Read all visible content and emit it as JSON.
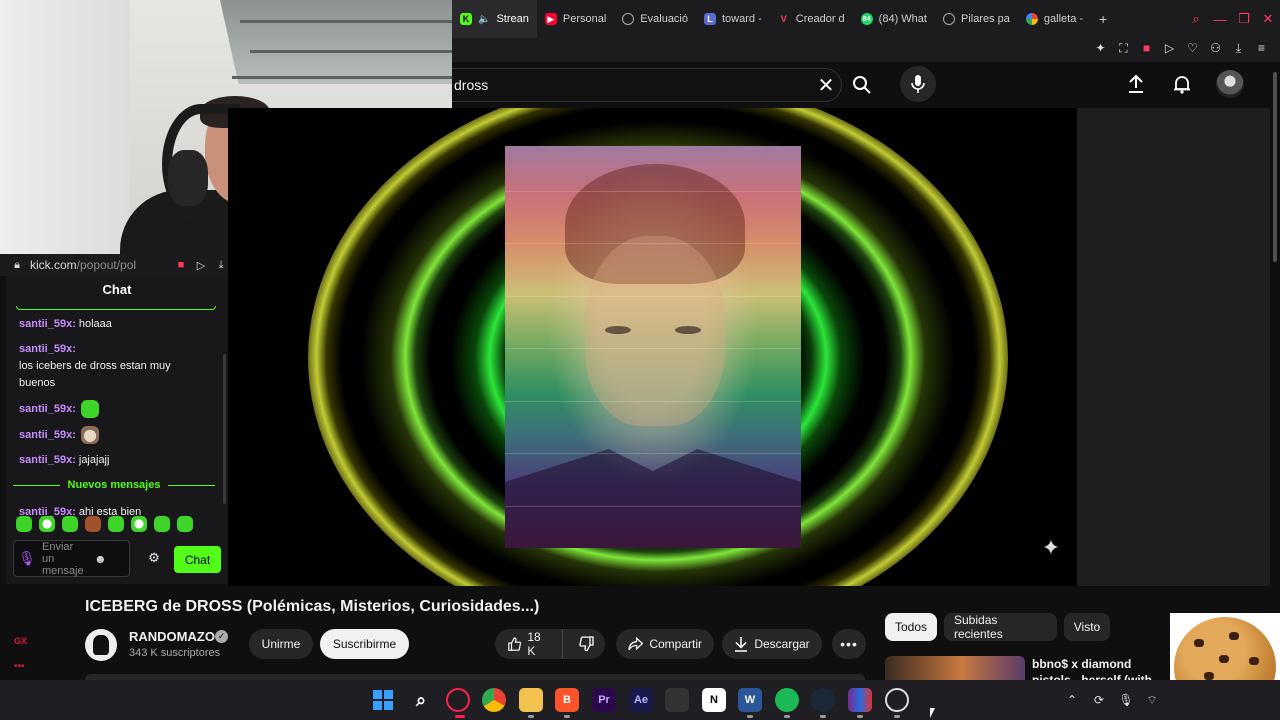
{
  "browser": {
    "tabs": [
      {
        "label": "Strean",
        "icon": "kick-icon",
        "color": "#53fc18",
        "active": true
      },
      {
        "label": "Personal",
        "icon": "youtube-icon",
        "color": "#ff0033"
      },
      {
        "label": "Evaluació",
        "icon": "openai-icon",
        "color": "#9b9b9b"
      },
      {
        "label": "toward - ",
        "icon": "notion-icon",
        "color": "#5b6ad0"
      },
      {
        "label": "Creador d",
        "icon": "v-icon",
        "color": "#ff3b5c"
      },
      {
        "label": "(84) What",
        "icon": "whatsapp-icon",
        "color": "#25d366",
        "badge": "84"
      },
      {
        "label": "Pilares pa",
        "icon": "openai-icon",
        "color": "#9b9b9b"
      },
      {
        "label": "galleta - ",
        "icon": "google-icon",
        "color": "#4285f4"
      }
    ]
  },
  "youtube": {
    "search_query": "dross",
    "video_title": "ICEBERG de DROSS (Polémicas, Misterios, Curiosidades...)",
    "channel_name": "RANDOMAZO",
    "subscribers": "343 K suscriptores",
    "join_label": "Unirme",
    "subscribe_label": "Suscribirme",
    "likes": "18 K",
    "share_label": "Compartir",
    "download_label": "Descargar",
    "chips": [
      "Todos",
      "Subidas recientes",
      "Visto"
    ],
    "recommended_title": "bbno$ x diamond pistols - herself (with BENEE) (Official"
  },
  "popout": {
    "url_host": "kick.com",
    "url_path": "/popout/pol"
  },
  "chat": {
    "title": "Chat",
    "messages": [
      {
        "user": "santii_59x:",
        "text": "holaaa"
      },
      {
        "user": "santii_59x:",
        "text": "los icebers de dross estan muy buenos"
      },
      {
        "user": "santii_59x:",
        "text": "",
        "emote": "green-blob-emote"
      },
      {
        "user": "santii_59x:",
        "text": "",
        "emote": "cat-emote"
      },
      {
        "user": "santii_59x:",
        "text": "jajajajj"
      }
    ],
    "new_messages_label": "Nuevos mensajes",
    "after_new": {
      "user": "santii_59x:",
      "text": "ahi esta bien"
    },
    "input_placeholder": "Enviar un mensaje",
    "send_label": "Chat"
  },
  "sidebar": {
    "gx_label": "GX"
  },
  "colors": {
    "kick_green": "#53fc18",
    "chat_username": "#c78cff",
    "opera_red": "#e0173b"
  }
}
